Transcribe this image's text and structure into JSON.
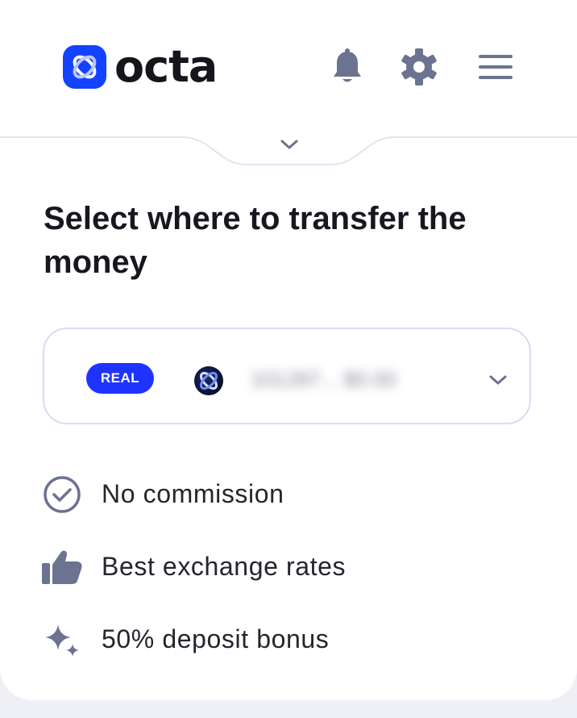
{
  "header": {
    "logo_text": "octa",
    "icons": [
      "bell-icon",
      "gear-icon",
      "menu-icon"
    ]
  },
  "colors": {
    "brand_blue": "#1443ff",
    "badge_blue": "#1f33ff",
    "icon_gray": "#6b7390",
    "border": "#d8dcf2"
  },
  "title": "Select where to transfer the money",
  "account_selector": {
    "badge": "REAL",
    "account_value": "101287... $0.00"
  },
  "features": [
    {
      "icon": "check-circle-icon",
      "label": "No commission"
    },
    {
      "icon": "thumbs-up-icon",
      "label": "Best exchange rates"
    },
    {
      "icon": "sparkles-icon",
      "label": "50% deposit bonus"
    }
  ]
}
